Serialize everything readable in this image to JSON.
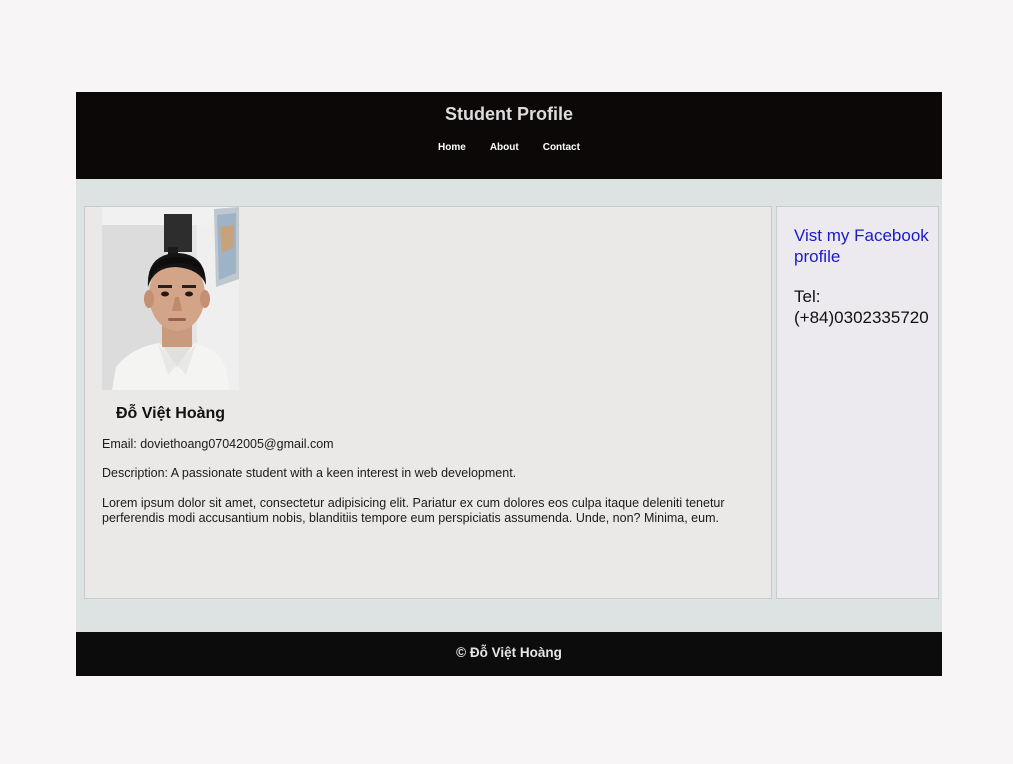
{
  "header": {
    "title": "Student Profile",
    "nav": [
      {
        "label": "Home"
      },
      {
        "label": "About"
      },
      {
        "label": "Contact"
      }
    ]
  },
  "profile": {
    "photo_alt": "Student portrait photo",
    "name": "Đỗ Việt Hoàng",
    "email_line": "Email: doviethoang07042005@gmail.com",
    "description_line": "Description: A passionate student with a keen interest in web development.",
    "lorem": "Lorem ipsum dolor sit amet, consectetur adipisicing elit. Pariatur ex cum dolores eos culpa itaque deleniti tenetur perferendis modi accusantium nobis, blanditiis tempore eum perspiciatis assumenda. Unde, non? Minima, eum."
  },
  "sidebar": {
    "facebook_link": "Vist my Facebook profile",
    "tel": "Tel: (+84)0302335720"
  },
  "footer": {
    "copyright": "© Đỗ Việt Hoàng"
  },
  "colors": {
    "header_bg": "#0d0808",
    "link_blue": "#1a1ac8",
    "page_bg": "#dde2e2"
  }
}
